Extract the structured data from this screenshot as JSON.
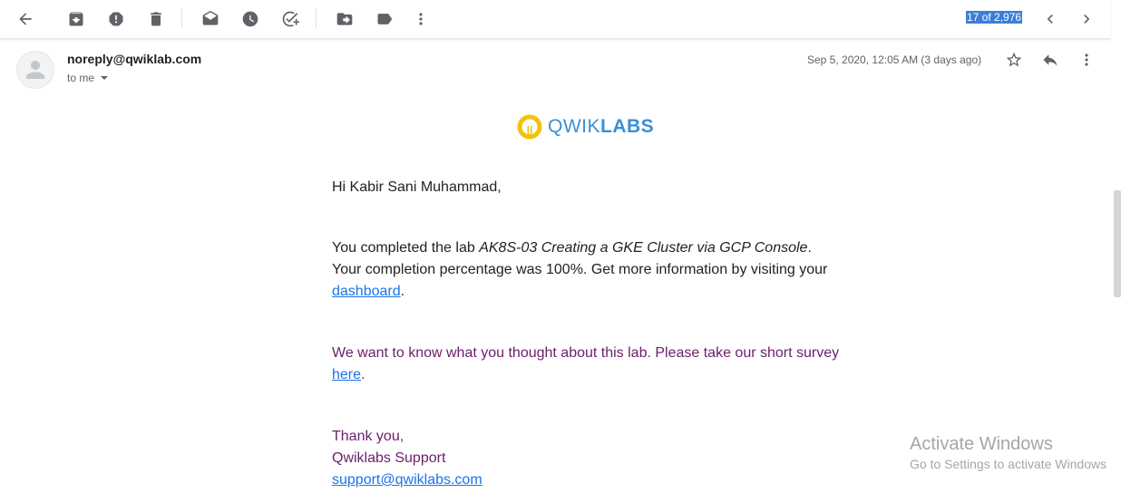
{
  "toolbar": {
    "icons": [
      "back-arrow-icon",
      "archive-icon",
      "report-spam-icon",
      "delete-icon",
      "mark-unread-icon",
      "snooze-icon",
      "add-to-tasks-icon",
      "move-to-icon",
      "label-icon",
      "more-vert-icon"
    ],
    "pager": "17 of 2,976"
  },
  "message": {
    "sender": "noreply@qwiklab.com",
    "recipient": "to me",
    "date": "Sep 5, 2020, 12:05 AM (3 days ago)"
  },
  "email": {
    "logo_light": "QWIK",
    "logo_bold": "LABS",
    "greeting": "Hi Kabir Sani Muhammad,",
    "p1_a": "You completed the lab ",
    "lab_name": "AK8S-03 Creating a GKE Cluster via GCP Console",
    "p1_b": ". Your completion percentage was 100%. Get more information by visiting your ",
    "dashboard_link": "dashboard",
    "p1_c": ".",
    "p2_a": "We want to know what you thought about this lab. Please take our short survey ",
    "survey_link": "here",
    "p2_b": ".",
    "thanks": "Thank you,",
    "team": "Qwiklabs Support",
    "support_email": "support@qwiklabs.com"
  },
  "watermark": {
    "title": "Activate Windows",
    "subtitle": "Go to Settings to activate Windows"
  },
  "colors": {
    "link": "#1a73e8",
    "survey_text": "#6b1e6b",
    "logo_blue": "#3a8fd6",
    "logo_yellow": "#f4c20d",
    "pager_highlight": "#3b7fd9"
  }
}
